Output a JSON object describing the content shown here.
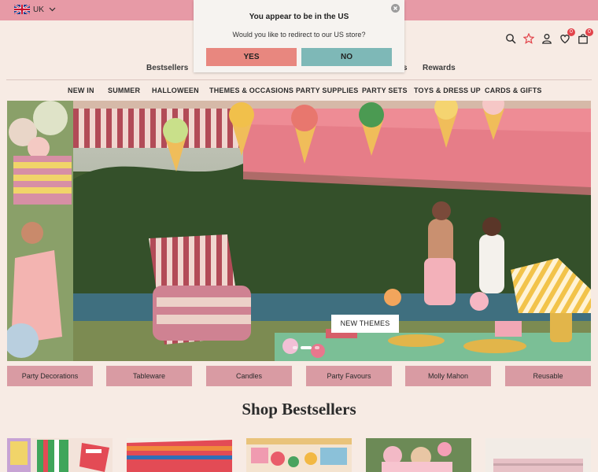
{
  "locale": {
    "country": "UK",
    "flag_icon": "uk-flag-icon"
  },
  "header": {
    "icons": [
      "search-icon",
      "star-icon",
      "account-icon",
      "wishlist-heart-icon",
      "cart-bag-icon"
    ],
    "wishlist_count": "0",
    "cart_count": "0",
    "colors": {
      "topbar": "#e79aa6",
      "badge": "#e2434a",
      "star": "#e2434a"
    }
  },
  "subnav": {
    "bestsellers": "Bestsellers",
    "partial": "s",
    "rewards": "Rewards"
  },
  "nav": {
    "items": [
      "NEW IN",
      "SUMMER",
      "HALLOWEEN",
      "THEMES & OCCASIONS",
      "PARTY SUPPLIES",
      "PARTY SETS",
      "TOYS & DRESS UP",
      "CARDS & GIFTS"
    ]
  },
  "hero": {
    "cta": "NEW THEMES",
    "slide_count": 3,
    "active_slide": 1
  },
  "categories": [
    "Party Decorations",
    "Tableware",
    "Candles",
    "Party Favours",
    "Molly Mahon",
    "Reusable"
  ],
  "section": {
    "title": "Shop Bestsellers"
  },
  "modal": {
    "title": "You appear to be in the US",
    "message": "Would you like to redirect to our US store?",
    "yes_label": "YES",
    "no_label": "NO",
    "colors": {
      "yes": "#e8877f",
      "no": "#7eb8b7"
    }
  },
  "colors": {
    "page_bg": "#f7ebe4",
    "category_bg": "#d99ba3"
  }
}
